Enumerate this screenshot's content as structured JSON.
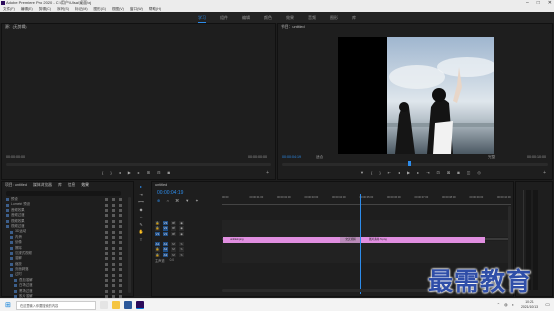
{
  "title_bar": {
    "title": "Adobe Premiere Pro 2020 - C:\\用户\\Ulsa\\桌面\\xj",
    "controls": [
      "–",
      "□",
      "✕"
    ]
  },
  "menu": [
    "文件(F)",
    "编辑(E)",
    "剪辑(C)",
    "序列(S)",
    "标记(M)",
    "图形(G)",
    "视图(V)",
    "窗口(W)",
    "帮助(H)"
  ],
  "workspaces": [
    "学习",
    "组件",
    "编辑",
    "颜色",
    "效果",
    "音频",
    "图形",
    "库"
  ],
  "source_panel": {
    "tab": "源：(无剪辑)",
    "tc_left": "00:00:00:00",
    "tc_right": "00:00:00:00"
  },
  "program_panel": {
    "tab": "节目：untitled",
    "tc_current": "00:00:04:19",
    "fit": "适合",
    "quality": "完整",
    "tc_total": "00:00:10:00"
  },
  "effects_panel": {
    "tabs": [
      "项目: untitled",
      "媒体浏览器",
      "库",
      "信息",
      "效果"
    ],
    "items": [
      "预设",
      "Lumetri 预设",
      "音频效果",
      "音频过渡",
      "视频效果",
      "视频过渡",
      "3D运动",
      "内滑",
      "划像",
      "擦除",
      "沉浸式视频",
      "溶解",
      "缩放",
      "页面剥落",
      "过时",
      "叠加溶解",
      "白场过渡",
      "黑场过渡",
      "胶片溶解",
      "非叠加溶解"
    ]
  },
  "timeline": {
    "tab": "untitled",
    "tc": "00:00:04:19",
    "ruler": [
      "00:00",
      "00:00:01:00",
      "00:00:02:00",
      "00:00:03:00",
      "00:00:04:00",
      "00:00:05:00",
      "00:00:06:00",
      "00:00:07:00",
      "00:00:08:00",
      "00:00:09:00",
      "00:00:10:00"
    ],
    "video_tracks": [
      "V3",
      "V2",
      "V1"
    ],
    "audio_tracks": [
      "A1",
      "A2",
      "A3"
    ],
    "master_label": "主声道",
    "master_value": "0.0",
    "clip1": "untitled.png",
    "clip2": "图片素材-5.png",
    "transition": "交叉溶解",
    "playhead_fraction": 0.479
  },
  "watermark": "最需教育",
  "taskbar": {
    "search": "在这里输入你要搜索的内容",
    "time": "10:21",
    "date": "2021/10/13"
  },
  "colors": {
    "accent": "#2d8ceb",
    "clip": "#e08ee0",
    "window": "#1d1d1d"
  }
}
